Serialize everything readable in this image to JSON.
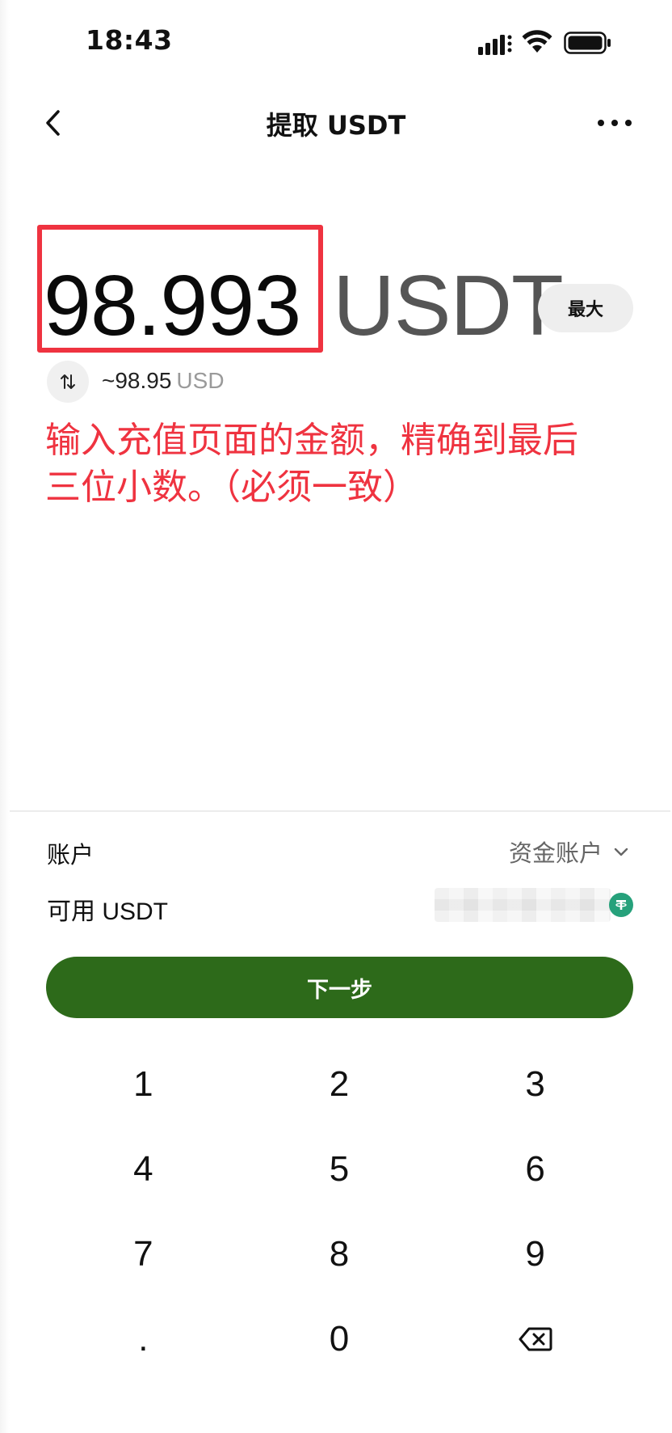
{
  "status_bar": {
    "time": "18:43"
  },
  "nav": {
    "title": "提取 USDT",
    "back_icon": "chevron-left-icon",
    "more_icon": "more-horizontal-icon"
  },
  "amount": {
    "value": "98.993",
    "unit": "USDT",
    "max_label": "最大",
    "converted_value": "~98.95",
    "converted_unit": "USD"
  },
  "annotation": {
    "text": "输入充值页面的金额，精确到最后三位小数。（必须一致）",
    "color": "#ef3340"
  },
  "account": {
    "label": "账户",
    "value": "资金账户"
  },
  "available": {
    "label": "可用 USDT"
  },
  "next_button": {
    "label": "下一步",
    "color": "#2d6a1a"
  },
  "keypad": {
    "keys": [
      "1",
      "2",
      "3",
      "4",
      "5",
      "6",
      "7",
      "8",
      "9",
      ".",
      "0"
    ],
    "backspace_icon": "backspace-icon"
  }
}
